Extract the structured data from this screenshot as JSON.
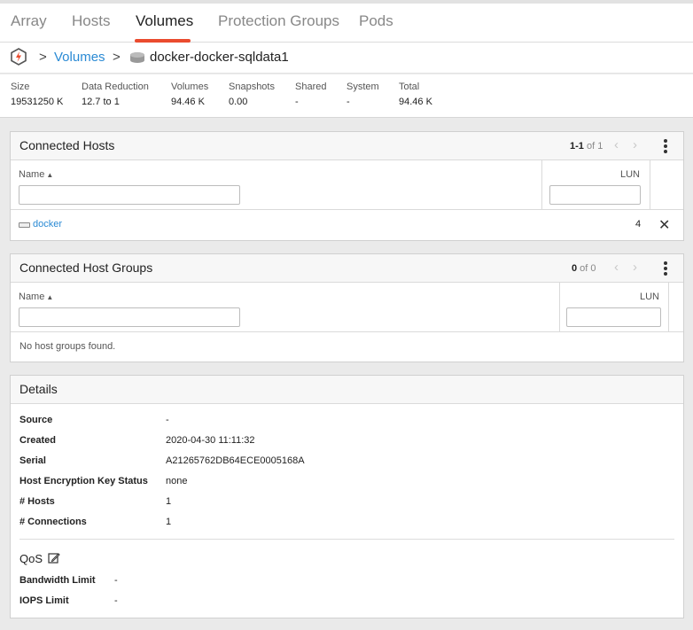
{
  "nav": {
    "tabs": [
      {
        "label": "Array"
      },
      {
        "label": "Hosts"
      },
      {
        "label": "Volumes"
      },
      {
        "label": "Protection Groups"
      },
      {
        "label": "Pods"
      }
    ],
    "active_tab": "Volumes",
    "accent_color": "#ea4b2e"
  },
  "breadcrumb": {
    "sep1": ">",
    "parent": "Volumes",
    "sep2": ">",
    "current": "docker-docker-sqldata1"
  },
  "stats": [
    {
      "label": "Size",
      "value": "19531250 K"
    },
    {
      "label": "Data Reduction",
      "value": "12.7 to 1"
    },
    {
      "label": "Volumes",
      "value": "94.46 K"
    },
    {
      "label": "Snapshots",
      "value": "0.00"
    },
    {
      "label": "Shared",
      "value": "-"
    },
    {
      "label": "System",
      "value": "-"
    },
    {
      "label": "Total",
      "value": "94.46 K"
    }
  ],
  "connected_hosts": {
    "title": "Connected Hosts",
    "pager_range": "1-1",
    "pager_total": " of 1",
    "col_name": "Name",
    "col_lun": "LUN",
    "rows": [
      {
        "name": "docker",
        "lun": "4"
      }
    ]
  },
  "connected_host_groups": {
    "title": "Connected Host Groups",
    "pager_range": "0",
    "pager_total": " of 0",
    "col_name": "Name",
    "col_lun": "LUN",
    "empty": "No host groups found."
  },
  "details": {
    "title": "Details",
    "rows": [
      {
        "label": "Source",
        "value": "-"
      },
      {
        "label": "Created",
        "value": "2020-04-30 11:11:32"
      },
      {
        "label": "Serial",
        "value": "A21265762DB64ECE0005168A"
      },
      {
        "label": "Host Encryption Key Status",
        "value": "none"
      },
      {
        "label": "# Hosts",
        "value": "1"
      },
      {
        "label": "# Connections",
        "value": "1"
      }
    ],
    "qos_title": "QoS",
    "qos_rows": [
      {
        "label": "Bandwidth Limit",
        "value": "-"
      },
      {
        "label": "IOPS Limit",
        "value": "-"
      }
    ]
  },
  "icons": {
    "array": "array-logo-icon",
    "volume": "volume-disk-icon",
    "host": "host-icon",
    "sort": "sort-ascending-icon",
    "prev": "chevron-left-icon",
    "next": "chevron-right-icon",
    "menu": "kebab-menu-icon",
    "remove": "close-icon",
    "edit": "edit-icon"
  }
}
